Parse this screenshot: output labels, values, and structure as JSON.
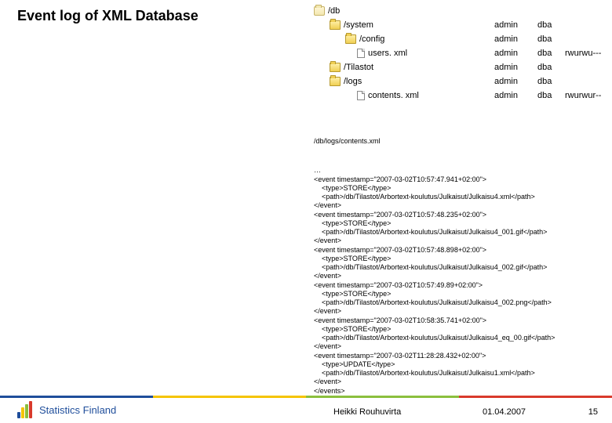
{
  "title": "Event log of XML Database",
  "tree": {
    "root": "/db",
    "rows": [
      {
        "indent": 20,
        "icon": "folder",
        "label": "/system",
        "user": "admin",
        "group": "dba",
        "perm": ""
      },
      {
        "indent": 40,
        "icon": "folder",
        "label": "/config",
        "user": "admin",
        "group": "dba",
        "perm": ""
      },
      {
        "indent": 55,
        "icon": "file",
        "label": "users. xml",
        "user": "admin",
        "group": "dba",
        "perm": "rwurwu---"
      },
      {
        "indent": 20,
        "icon": "folder",
        "label": "/Tilastot",
        "user": "admin",
        "group": "dba",
        "perm": ""
      },
      {
        "indent": 20,
        "icon": "folder",
        "label": "/logs",
        "user": "admin",
        "group": "dba",
        "perm": ""
      },
      {
        "indent": 55,
        "icon": "file",
        "label": "contents. xml",
        "user": "admin",
        "group": "dba",
        "perm": "rwurwur--"
      }
    ]
  },
  "log": {
    "filename": "/db/logs/contents.xml",
    "events": [
      {
        "ts": "2007-03-02T10:57:47.941+02:00",
        "type": "STORE",
        "path": "/db/Tilastot/Arbortext-koulutus/Julkaisut/Julkaisu4.xml"
      },
      {
        "ts": "2007-03-02T10:57:48.235+02:00",
        "type": "STORE",
        "path": "/db/Tilastot/Arbortext-koulutus/Julkaisut/Julkaisu4_001.gif"
      },
      {
        "ts": "2007-03-02T10:57:48.898+02:00",
        "type": "STORE",
        "path": "/db/Tilastot/Arbortext-koulutus/Julkaisut/Julkaisu4_002.gif"
      },
      {
        "ts": "2007-03-02T10:57:49.89+02:00",
        "type": "STORE",
        "path": "/db/Tilastot/Arbortext-koulutus/Julkaisut/Julkaisu4_002.png"
      },
      {
        "ts": "2007-03-02T10:58:35.741+02:00",
        "type": "STORE",
        "path": "/db/Tilastot/Arbortext-koulutus/Julkaisut/Julkaisu4_eq_00.gif"
      },
      {
        "ts": "2007-03-02T11:28:28.432+02:00",
        "type": "UPDATE",
        "path": "/db/Tilastot/Arbortext-koulutus/Julkaisut/Julkaisu1.xml"
      }
    ]
  },
  "footer": {
    "org": "Statistics Finland",
    "author": "Heikki Rouhuvirta",
    "date": "01.04.2007",
    "page": "15"
  }
}
